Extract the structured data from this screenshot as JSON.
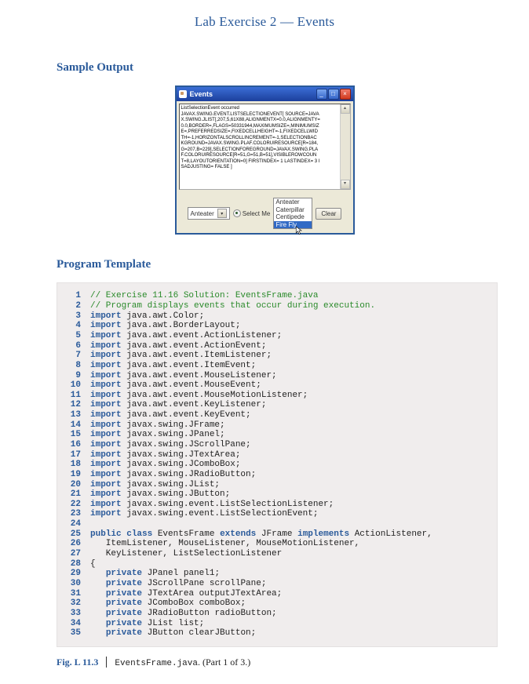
{
  "page_title": "Lab Exercise 2 — Events",
  "sections": {
    "sample_output": "Sample Output",
    "program_template": "Program Template"
  },
  "swing_window": {
    "title": "Events",
    "textarea_lines": [
      "ListSelectionEvent occurred",
      "JAVAX.SWING.EVENT.LISTSELECTIONEVENT[ SOURCE=JAVA",
      "X.SWING.JLIST[,207,5,61X88,ALIGNMENTX=0.0,ALIGNMENTY=",
      "0.0,BORDER=,FLAGS=50331944,MAXIMUMSIZE=,MINIMUMSIZ",
      "E=,PREFERREDSIZE=,FIXEDCELLHEIGHT=-1,FIXEDCELLWID",
      "TH=-1,HORIZONTALSCROLLINCREMENT=-1,SELECTIONBAC",
      "KGROUND=JAVAX.SWING.PLAF.COLORUIRESOURCE[R=184,",
      "G=207,B=229],SELECTIONFOREGROUND=JAVAX.SWING.PLA",
      "F.COLORUIRESOURCE[R=51,G=51,B=51],VISIBLEROWCOUN",
      "T=8,LAYOUTORIENTATION=0] FIRSTINDEX= 1 LASTINDEX= 3 I",
      "SADJUSTING= FALSE ]"
    ],
    "combo_value": "Anteater",
    "radio_label": "Select Me",
    "list_items": [
      "Anteater",
      "Caterpillar",
      "Centipede",
      "Fire Fly"
    ],
    "clear_label": "Clear"
  },
  "code_lines": [
    {
      "n": 1,
      "tokens": [
        [
          "comment",
          "// Exercise 11.16 Solution: EventsFrame.java"
        ]
      ]
    },
    {
      "n": 2,
      "tokens": [
        [
          "comment",
          "// Program displays events that occur during execution."
        ]
      ]
    },
    {
      "n": 3,
      "tokens": [
        [
          "keyword",
          "import"
        ],
        [
          "plain",
          " java.awt.Color;"
        ]
      ]
    },
    {
      "n": 4,
      "tokens": [
        [
          "keyword",
          "import"
        ],
        [
          "plain",
          " java.awt.BorderLayout;"
        ]
      ]
    },
    {
      "n": 5,
      "tokens": [
        [
          "keyword",
          "import"
        ],
        [
          "plain",
          " java.awt.event.ActionListener;"
        ]
      ]
    },
    {
      "n": 6,
      "tokens": [
        [
          "keyword",
          "import"
        ],
        [
          "plain",
          " java.awt.event.ActionEvent;"
        ]
      ]
    },
    {
      "n": 7,
      "tokens": [
        [
          "keyword",
          "import"
        ],
        [
          "plain",
          " java.awt.event.ItemListener;"
        ]
      ]
    },
    {
      "n": 8,
      "tokens": [
        [
          "keyword",
          "import"
        ],
        [
          "plain",
          " java.awt.event.ItemEvent;"
        ]
      ]
    },
    {
      "n": 9,
      "tokens": [
        [
          "keyword",
          "import"
        ],
        [
          "plain",
          " java.awt.event.MouseListener;"
        ]
      ]
    },
    {
      "n": 10,
      "tokens": [
        [
          "keyword",
          "import"
        ],
        [
          "plain",
          " java.awt.event.MouseEvent;"
        ]
      ]
    },
    {
      "n": 11,
      "tokens": [
        [
          "keyword",
          "import"
        ],
        [
          "plain",
          " java.awt.event.MouseMotionListener;"
        ]
      ]
    },
    {
      "n": 12,
      "tokens": [
        [
          "keyword",
          "import"
        ],
        [
          "plain",
          " java.awt.event.KeyListener;"
        ]
      ]
    },
    {
      "n": 13,
      "tokens": [
        [
          "keyword",
          "import"
        ],
        [
          "plain",
          " java.awt.event.KeyEvent;"
        ]
      ]
    },
    {
      "n": 14,
      "tokens": [
        [
          "keyword",
          "import"
        ],
        [
          "plain",
          " javax.swing.JFrame;"
        ]
      ]
    },
    {
      "n": 15,
      "tokens": [
        [
          "keyword",
          "import"
        ],
        [
          "plain",
          " javax.swing.JPanel;"
        ]
      ]
    },
    {
      "n": 16,
      "tokens": [
        [
          "keyword",
          "import"
        ],
        [
          "plain",
          " javax.swing.JScrollPane;"
        ]
      ]
    },
    {
      "n": 17,
      "tokens": [
        [
          "keyword",
          "import"
        ],
        [
          "plain",
          " javax.swing.JTextArea;"
        ]
      ]
    },
    {
      "n": 18,
      "tokens": [
        [
          "keyword",
          "import"
        ],
        [
          "plain",
          " javax.swing.JComboBox;"
        ]
      ]
    },
    {
      "n": 19,
      "tokens": [
        [
          "keyword",
          "import"
        ],
        [
          "plain",
          " javax.swing.JRadioButton;"
        ]
      ]
    },
    {
      "n": 20,
      "tokens": [
        [
          "keyword",
          "import"
        ],
        [
          "plain",
          " javax.swing.JList;"
        ]
      ]
    },
    {
      "n": 21,
      "tokens": [
        [
          "keyword",
          "import"
        ],
        [
          "plain",
          " javax.swing.JButton;"
        ]
      ]
    },
    {
      "n": 22,
      "tokens": [
        [
          "keyword",
          "import"
        ],
        [
          "plain",
          " javax.swing.event.ListSelectionListener;"
        ]
      ]
    },
    {
      "n": 23,
      "tokens": [
        [
          "keyword",
          "import"
        ],
        [
          "plain",
          " javax.swing.event.ListSelectionEvent;"
        ]
      ]
    },
    {
      "n": 24,
      "tokens": []
    },
    {
      "n": 25,
      "tokens": [
        [
          "keyword",
          "public"
        ],
        [
          "plain",
          " "
        ],
        [
          "keyword",
          "class"
        ],
        [
          "plain",
          " EventsFrame "
        ],
        [
          "keyword",
          "extends"
        ],
        [
          "plain",
          " JFrame "
        ],
        [
          "keyword",
          "implements"
        ],
        [
          "plain",
          " ActionListener,"
        ]
      ]
    },
    {
      "n": 26,
      "tokens": [
        [
          "plain",
          "   ItemListener, MouseListener, MouseMotionListener,"
        ]
      ]
    },
    {
      "n": 27,
      "tokens": [
        [
          "plain",
          "   KeyListener, ListSelectionListener"
        ]
      ]
    },
    {
      "n": 28,
      "tokens": [
        [
          "plain",
          "{"
        ]
      ]
    },
    {
      "n": 29,
      "tokens": [
        [
          "plain",
          "   "
        ],
        [
          "keyword",
          "private"
        ],
        [
          "plain",
          " JPanel panel1;"
        ]
      ]
    },
    {
      "n": 30,
      "tokens": [
        [
          "plain",
          "   "
        ],
        [
          "keyword",
          "private"
        ],
        [
          "plain",
          " JScrollPane scrollPane;"
        ]
      ]
    },
    {
      "n": 31,
      "tokens": [
        [
          "plain",
          "   "
        ],
        [
          "keyword",
          "private"
        ],
        [
          "plain",
          " JTextArea outputJTextArea;"
        ]
      ]
    },
    {
      "n": 32,
      "tokens": [
        [
          "plain",
          "   "
        ],
        [
          "keyword",
          "private"
        ],
        [
          "plain",
          " JComboBox comboBox;"
        ]
      ]
    },
    {
      "n": 33,
      "tokens": [
        [
          "plain",
          "   "
        ],
        [
          "keyword",
          "private"
        ],
        [
          "plain",
          " JRadioButton radioButton;"
        ]
      ]
    },
    {
      "n": 34,
      "tokens": [
        [
          "plain",
          "   "
        ],
        [
          "keyword",
          "private"
        ],
        [
          "plain",
          " JList list;"
        ]
      ]
    },
    {
      "n": 35,
      "tokens": [
        [
          "plain",
          "   "
        ],
        [
          "keyword",
          "private"
        ],
        [
          "plain",
          " JButton clearJButton;"
        ]
      ]
    }
  ],
  "figure": {
    "label": "Fig. L 11.3",
    "filename": "EventsFrame.java",
    "rest": ". (Part 1 of 3.)"
  }
}
